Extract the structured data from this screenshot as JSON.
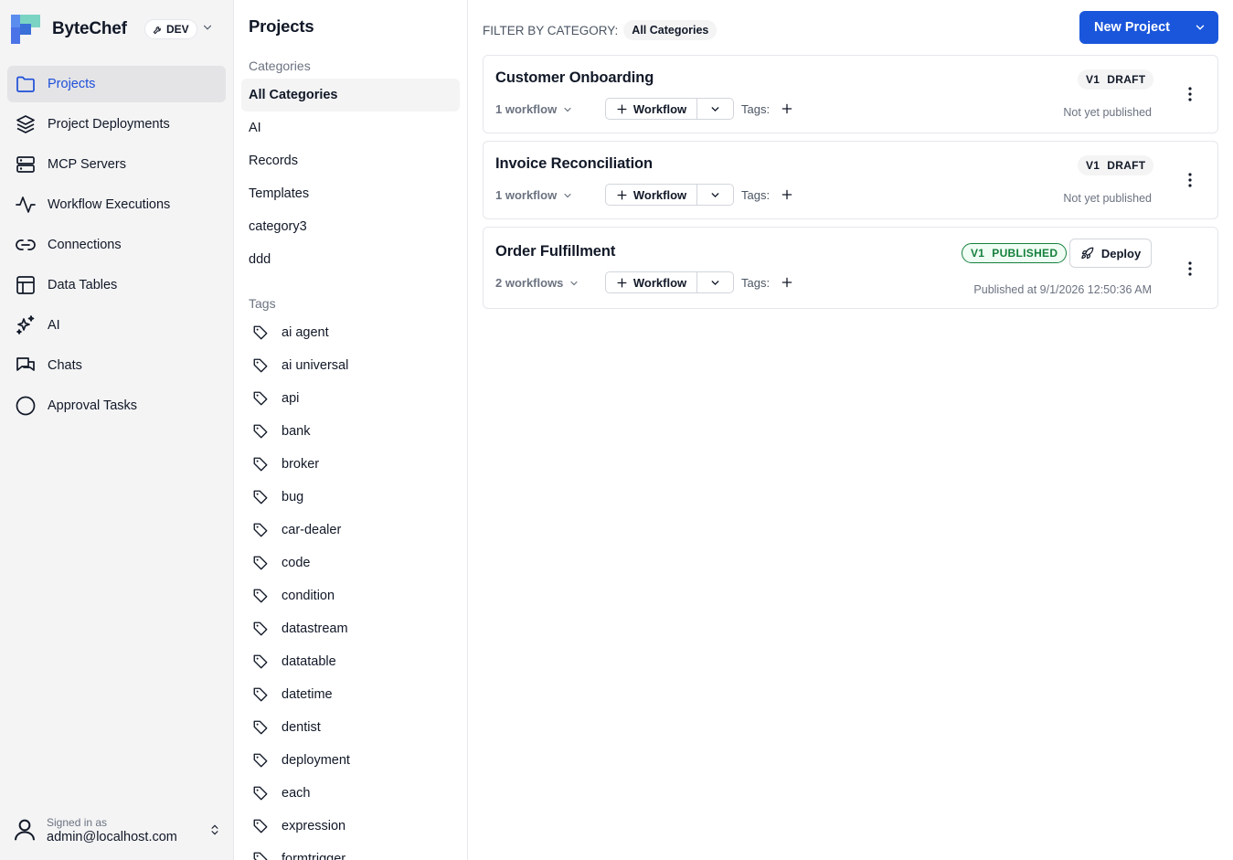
{
  "app": {
    "name": "ByteChef",
    "environment": "DEV"
  },
  "sidebar": {
    "items": [
      {
        "label": "Projects",
        "icon": "folder-icon",
        "active": true
      },
      {
        "label": "Project Deployments",
        "icon": "layers-icon"
      },
      {
        "label": "MCP Servers",
        "icon": "server-icon"
      },
      {
        "label": "Workflow Executions",
        "icon": "activity-icon"
      },
      {
        "label": "Connections",
        "icon": "link-icon"
      },
      {
        "label": "Data Tables",
        "icon": "table-icon"
      },
      {
        "label": "AI",
        "icon": "sparkles-icon"
      },
      {
        "label": "Chats",
        "icon": "chat-icon"
      },
      {
        "label": "Approval Tasks",
        "icon": "circle-icon"
      }
    ],
    "user": {
      "signed_in_label": "Signed in as",
      "email": "admin@localhost.com"
    }
  },
  "categories_panel": {
    "title": "Projects",
    "categories_heading": "Categories",
    "categories": [
      "All Categories",
      "AI",
      "Records",
      "Templates",
      "category3",
      "ddd"
    ],
    "tags_heading": "Tags",
    "tags": [
      "ai agent",
      "ai universal",
      "api",
      "bank",
      "broker",
      "bug",
      "car-dealer",
      "code",
      "condition",
      "datastream",
      "datatable",
      "datetime",
      "dentist",
      "deployment",
      "each",
      "expression",
      "formtrigger"
    ]
  },
  "main": {
    "filter_label": "FILTER BY CATEGORY:",
    "filter_value": "All Categories",
    "new_project_label": "New Project",
    "workflow_button_label": "Workflow",
    "tags_label": "Tags:",
    "deploy_label": "Deploy",
    "projects": [
      {
        "title": "Customer Onboarding",
        "workflows": "1 workflow",
        "version": "V1",
        "status": "DRAFT",
        "published_text": "Not yet published"
      },
      {
        "title": "Invoice Reconciliation",
        "workflows": "1 workflow",
        "version": "V1",
        "status": "DRAFT",
        "published_text": "Not yet published"
      },
      {
        "title": "Order Fulfillment",
        "workflows": "2 workflows",
        "version": "V1",
        "status": "PUBLISHED",
        "published_text": "Published at 9/1/2026 12:50:36 AM"
      }
    ]
  },
  "colors": {
    "primary": "#1a56db",
    "active_nav_text": "#1d4ed8",
    "published_green": "#15803d",
    "sidebar_bg": "#f4f4f5"
  }
}
